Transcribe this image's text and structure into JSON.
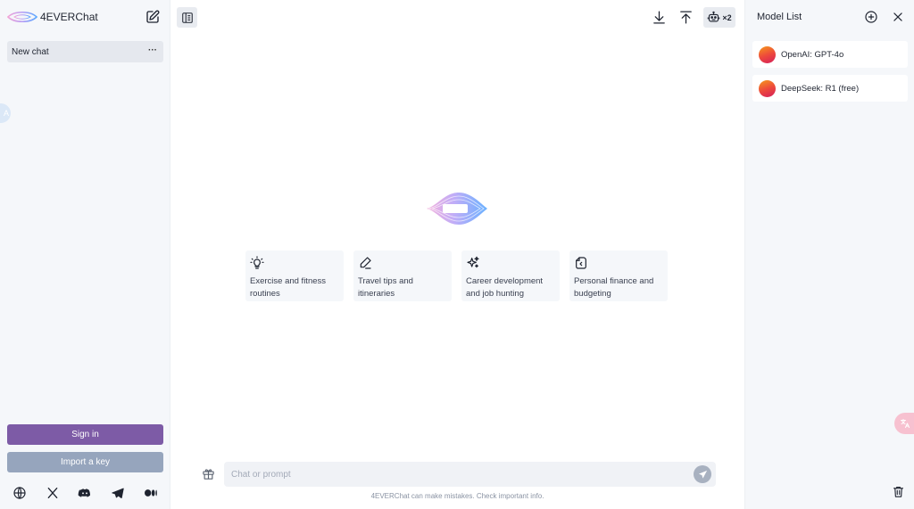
{
  "app": {
    "name": "4EVERChat"
  },
  "sidebar": {
    "chats": [
      {
        "title": "New chat",
        "more": "···"
      }
    ],
    "sign_in_label": "Sign in",
    "import_key_label": "Import a key",
    "translate_badge": "A"
  },
  "header": {
    "model_count": "×2"
  },
  "suggestions": [
    {
      "icon": "lightbulb-icon",
      "text": "Exercise and fitness routines"
    },
    {
      "icon": "pen-icon",
      "text": "Travel tips and itineraries"
    },
    {
      "icon": "sparkles-icon",
      "text": "Career development and job hunting"
    },
    {
      "icon": "file-icon",
      "text": "Personal finance and budgeting"
    }
  ],
  "composer": {
    "placeholder": "Chat or prompt",
    "value": "",
    "disclaimer": "4EVERChat can make mistakes. Check important info."
  },
  "model_panel": {
    "title": "Model List",
    "models": [
      {
        "name": "OpenAI: GPT-4o"
      },
      {
        "name": "DeepSeek: R1 (free)"
      }
    ]
  },
  "colors": {
    "primary": "#7d5ba6",
    "secondary": "#96a5bd",
    "sidebar_bg": "#f5f7fa",
    "logo_pink": "#f0a6d8",
    "logo_blue": "#5aa9ff"
  }
}
